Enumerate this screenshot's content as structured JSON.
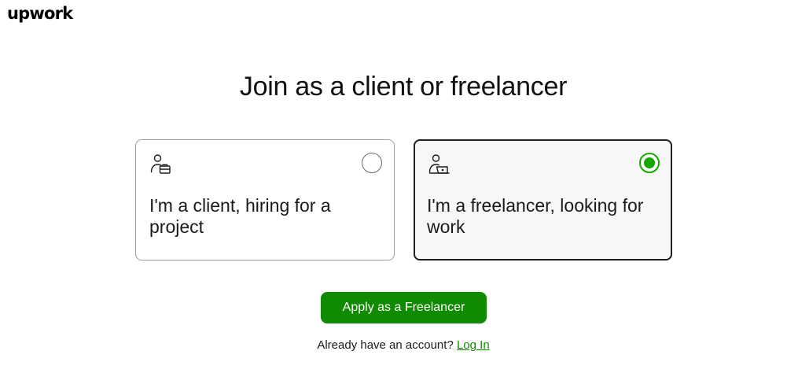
{
  "brand": {
    "logo_text": "upwork"
  },
  "page": {
    "title": "Join as a client or freelancer"
  },
  "options": [
    {
      "label": "I'm a client, hiring for a project",
      "icon": "person-briefcase-icon",
      "selected": false
    },
    {
      "label": "I'm a freelancer, looking for work",
      "icon": "person-laptop-icon",
      "selected": true
    }
  ],
  "actions": {
    "primary_label": "Apply as a Freelancer",
    "login_prompt": "Already have an account?",
    "login_link": "Log In"
  },
  "colors": {
    "accent": "#14a800",
    "button": "#108a00",
    "link": "#108a00",
    "selected_card_bg": "#f7f7f7",
    "selected_card_border": "#1f1f1f"
  }
}
